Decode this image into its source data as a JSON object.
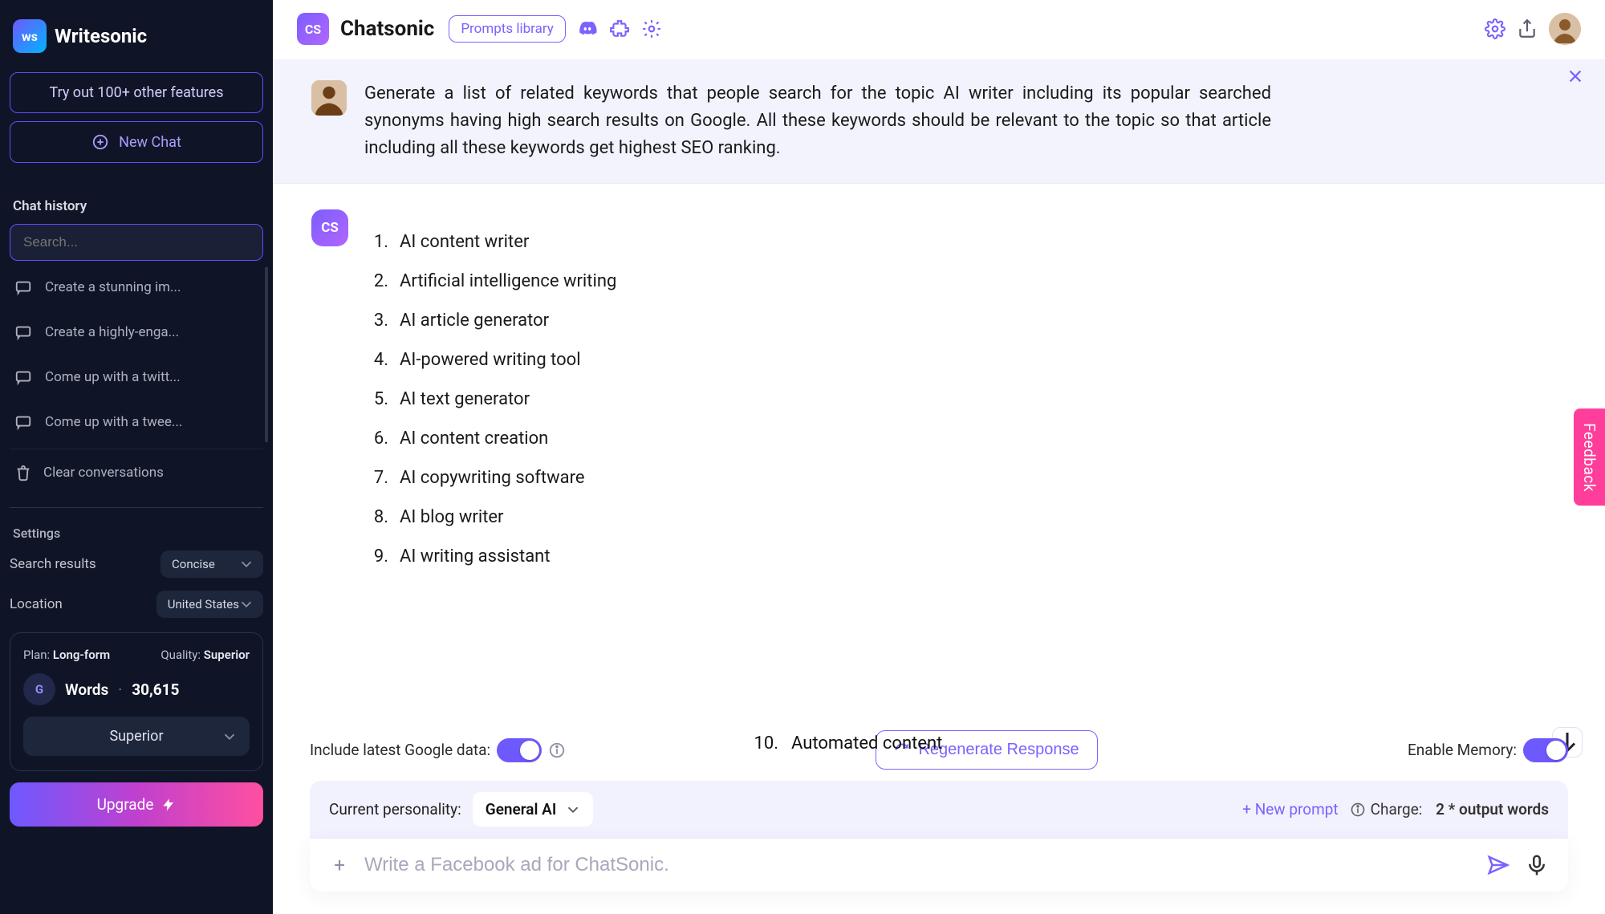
{
  "brand": {
    "badge": "ws",
    "name": "Writesonic"
  },
  "sidebar": {
    "tryButton": "Try out 100+ other features",
    "newChat": "New Chat",
    "historyHeading": "Chat history",
    "searchPlaceholder": "Search...",
    "history": [
      {
        "label": "Create a stunning im..."
      },
      {
        "label": "Create a highly-enga..."
      },
      {
        "label": "Come up with a twitt..."
      },
      {
        "label": "Come up with a twee..."
      }
    ],
    "clearConversations": "Clear conversations",
    "settingsHeading": "Settings",
    "settings": {
      "searchResultsLabel": "Search results",
      "searchResultsValue": "Concise",
      "locationLabel": "Location",
      "locationValue": "United States"
    },
    "planCard": {
      "planLabel": "Plan:",
      "planValue": "Long-form",
      "qualityLabel": "Quality:",
      "qualityValue": "Superior",
      "wordsLabel": "Words",
      "wordsCount": "30,615",
      "badge": "G",
      "tier": "Superior"
    },
    "upgrade": "Upgrade"
  },
  "topbar": {
    "appBadge": "CS",
    "appTitle": "Chatsonic",
    "promptsLibrary": "Prompts library"
  },
  "userMessage": "Generate a list of related keywords that people search for the topic AI writer including its popular searched synonyms having high search results on Google. All these keywords should be relevant to the topic so that article including all these keywords get highest SEO ranking.",
  "botAvatar": "CS",
  "answers": [
    "AI content writer",
    "Artificial intelligence writing",
    "AI article generator",
    "AI-powered writing tool",
    "AI text generator",
    "AI content creation",
    "AI copywriting software",
    "AI blog writer",
    "AI writing assistant"
  ],
  "cutoffItem": {
    "num": "10.",
    "text": "Automated content"
  },
  "controls": {
    "googleToggleLabel": "Include latest Google data:",
    "regenerate": "Regenerate Response",
    "memoryToggleLabel": "Enable Memory:",
    "personalityLabel": "Current personality:",
    "personalityValue": "General AI",
    "newPrompt": "+ New prompt",
    "chargeLabel": "Charge:",
    "chargeValue": "2 * output words",
    "composerPlaceholder": "Write a Facebook ad for ChatSonic."
  },
  "feedback": "Feedback"
}
